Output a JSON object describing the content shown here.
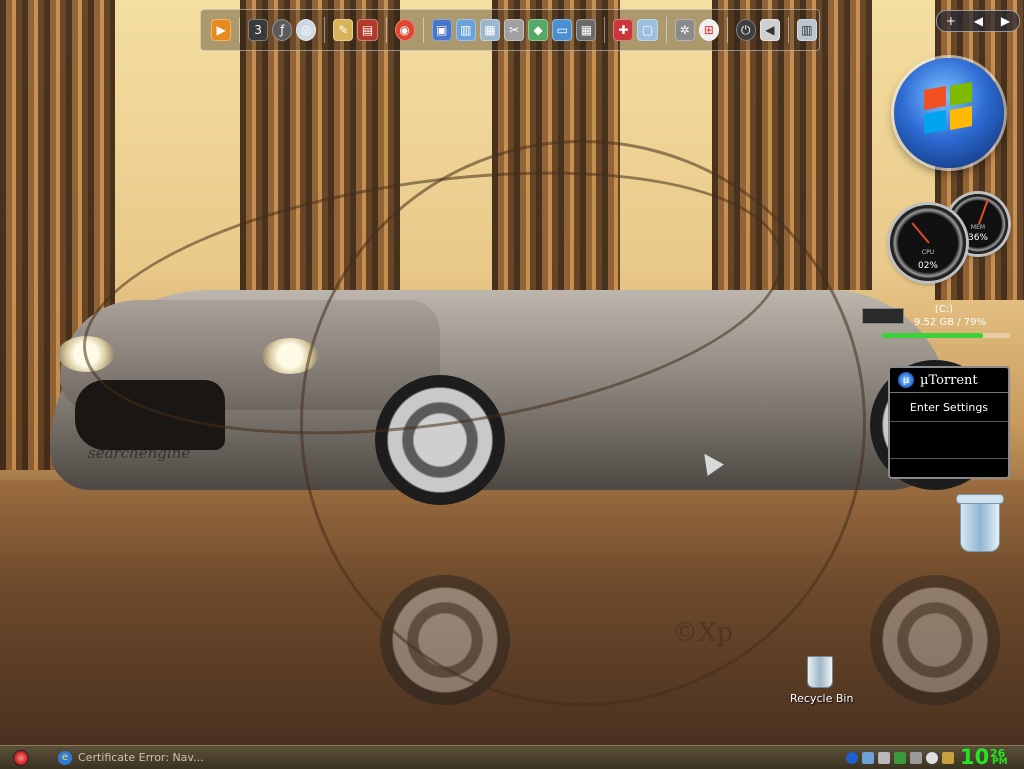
{
  "desktop": {
    "watermark": "©Xp",
    "car_script": "searchengine",
    "recycle_bin_label": "Recycle Bin"
  },
  "dock": {
    "icons": [
      "media-player-icon",
      "clapperboard-321-icon",
      "flash-icon",
      "disc-burner-icon",
      "paint-palette-icon",
      "books-icon",
      "chrome-like-icon",
      "computer-icon",
      "document-icon",
      "notepad-icon",
      "scissors-icon",
      "flowchart-icon",
      "monitor-icon",
      "keyboard-icon",
      "tools-icon",
      "window-icon",
      "network-icon",
      "windows-logo-icon",
      "power-icon",
      "volume-icon",
      "trash-icon"
    ]
  },
  "sidebar": {
    "cpu_gauge": {
      "label": "CPU",
      "value": "02%"
    },
    "mem_gauge": {
      "label": "MEM",
      "value": "36%"
    },
    "drive": {
      "name": "(C:)",
      "info": "9.52 GB / 79%",
      "used_fraction": 0.79
    },
    "utorrent": {
      "title": "µTorrent",
      "row1": "Enter Settings",
      "row2": "",
      "row3": ""
    }
  },
  "taskbar": {
    "task_label": "Certificate Error: Nav...",
    "clock_hour": "10",
    "clock_min": "26",
    "clock_ampm": "PM"
  },
  "colors": {
    "clock": "#23e523",
    "drive_fill": "#3ad13a"
  }
}
